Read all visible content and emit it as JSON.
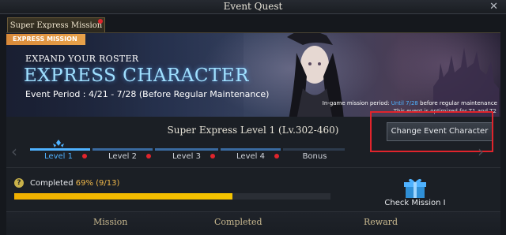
{
  "window": {
    "title": "Event Quest"
  },
  "tab": {
    "label": "Super Express Mission"
  },
  "banner": {
    "badge": "EXPRESS MISSION",
    "line1": "EXPAND YOUR ROSTER",
    "line2": "EXPRESS CHARACTER",
    "period": "Event Period : 4/21 - 7/28 (Before Regular Maintenance)",
    "ingame_prefix": "In-game mission period:",
    "ingame_date": "Until 7/28",
    "ingame_suffix": "before regular maintenance"
  },
  "notice": "This event is optimized for T1 and T2",
  "level_title": "Super Express Level 1 (Lv.302-460)",
  "change_button": "Change Event Character",
  "steps": [
    {
      "label": "Level 1"
    },
    {
      "label": "Level 2"
    },
    {
      "label": "Level 3"
    },
    {
      "label": "Level 4"
    },
    {
      "label": "Bonus"
    }
  ],
  "progress": {
    "prefix": "Completed",
    "percent_text": "69% (9/13)",
    "fraction": 0.69
  },
  "reward_button": "Check Mission I",
  "columns": {
    "mission": "Mission",
    "completed": "Completed",
    "reward": "Reward"
  },
  "colors": {
    "accent_blue": "#4fb2ff",
    "highlight_red": "#e0242c",
    "progress_yellow": "#f5c400"
  }
}
